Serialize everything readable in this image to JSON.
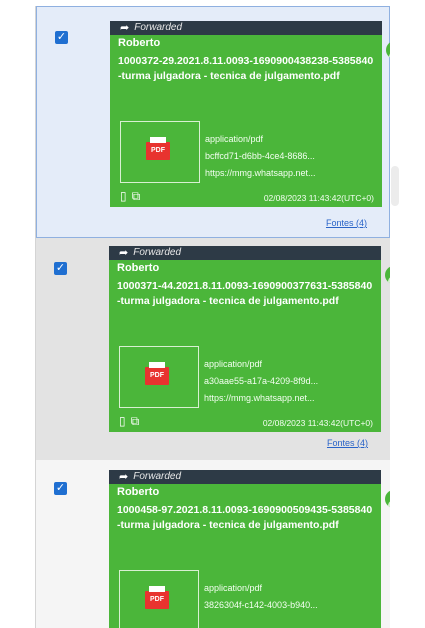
{
  "messages": [
    {
      "forwarded_label": "Forwarded",
      "sender": "Roberto",
      "filename": "1000372-29.2021.8.11.0093-1690900438238-5385840-turma julgadora - tecnica de julgamento.pdf",
      "mime": "application/pdf",
      "id": "bcffcd71-d6bb-4ce4-8686...",
      "url": "https://mmg.whatsapp.net...",
      "timestamp": "02/08/2023 11:43:42(UTC+0)",
      "fontes": "Fontes (4)",
      "checked": true
    },
    {
      "forwarded_label": "Forwarded",
      "sender": "Roberto",
      "filename": "1000371-44.2021.8.11.0093-1690900377631-5385840-turma julgadora - tecnica de julgamento.pdf",
      "mime": "application/pdf",
      "id": "a30aae55-a17a-4209-8f9d...",
      "url": "https://mmg.whatsapp.net...",
      "timestamp": "02/08/2023 11:43:42(UTC+0)",
      "fontes": "Fontes (4)",
      "checked": true
    },
    {
      "forwarded_label": "Forwarded",
      "sender": "Roberto",
      "filename": "1000458-97.2021.8.11.0093-1690900509435-5385840-turma julgadora - tecnica de julgamento.pdf",
      "mime": "application/pdf",
      "id": "3826304f-c142-4003-b940...",
      "checked": true
    }
  ],
  "icons": {
    "checkbox": "checkmark",
    "forward": "share-arrow",
    "attachment": "pdf-file",
    "avatar": "person-circle",
    "footer": [
      "bookmark",
      "gallery"
    ]
  },
  "colors": {
    "bubble": "#4bb63a",
    "forward_bar": "#2d3a46",
    "selected_row": "#e4ecf9",
    "link": "#2a64c8"
  }
}
